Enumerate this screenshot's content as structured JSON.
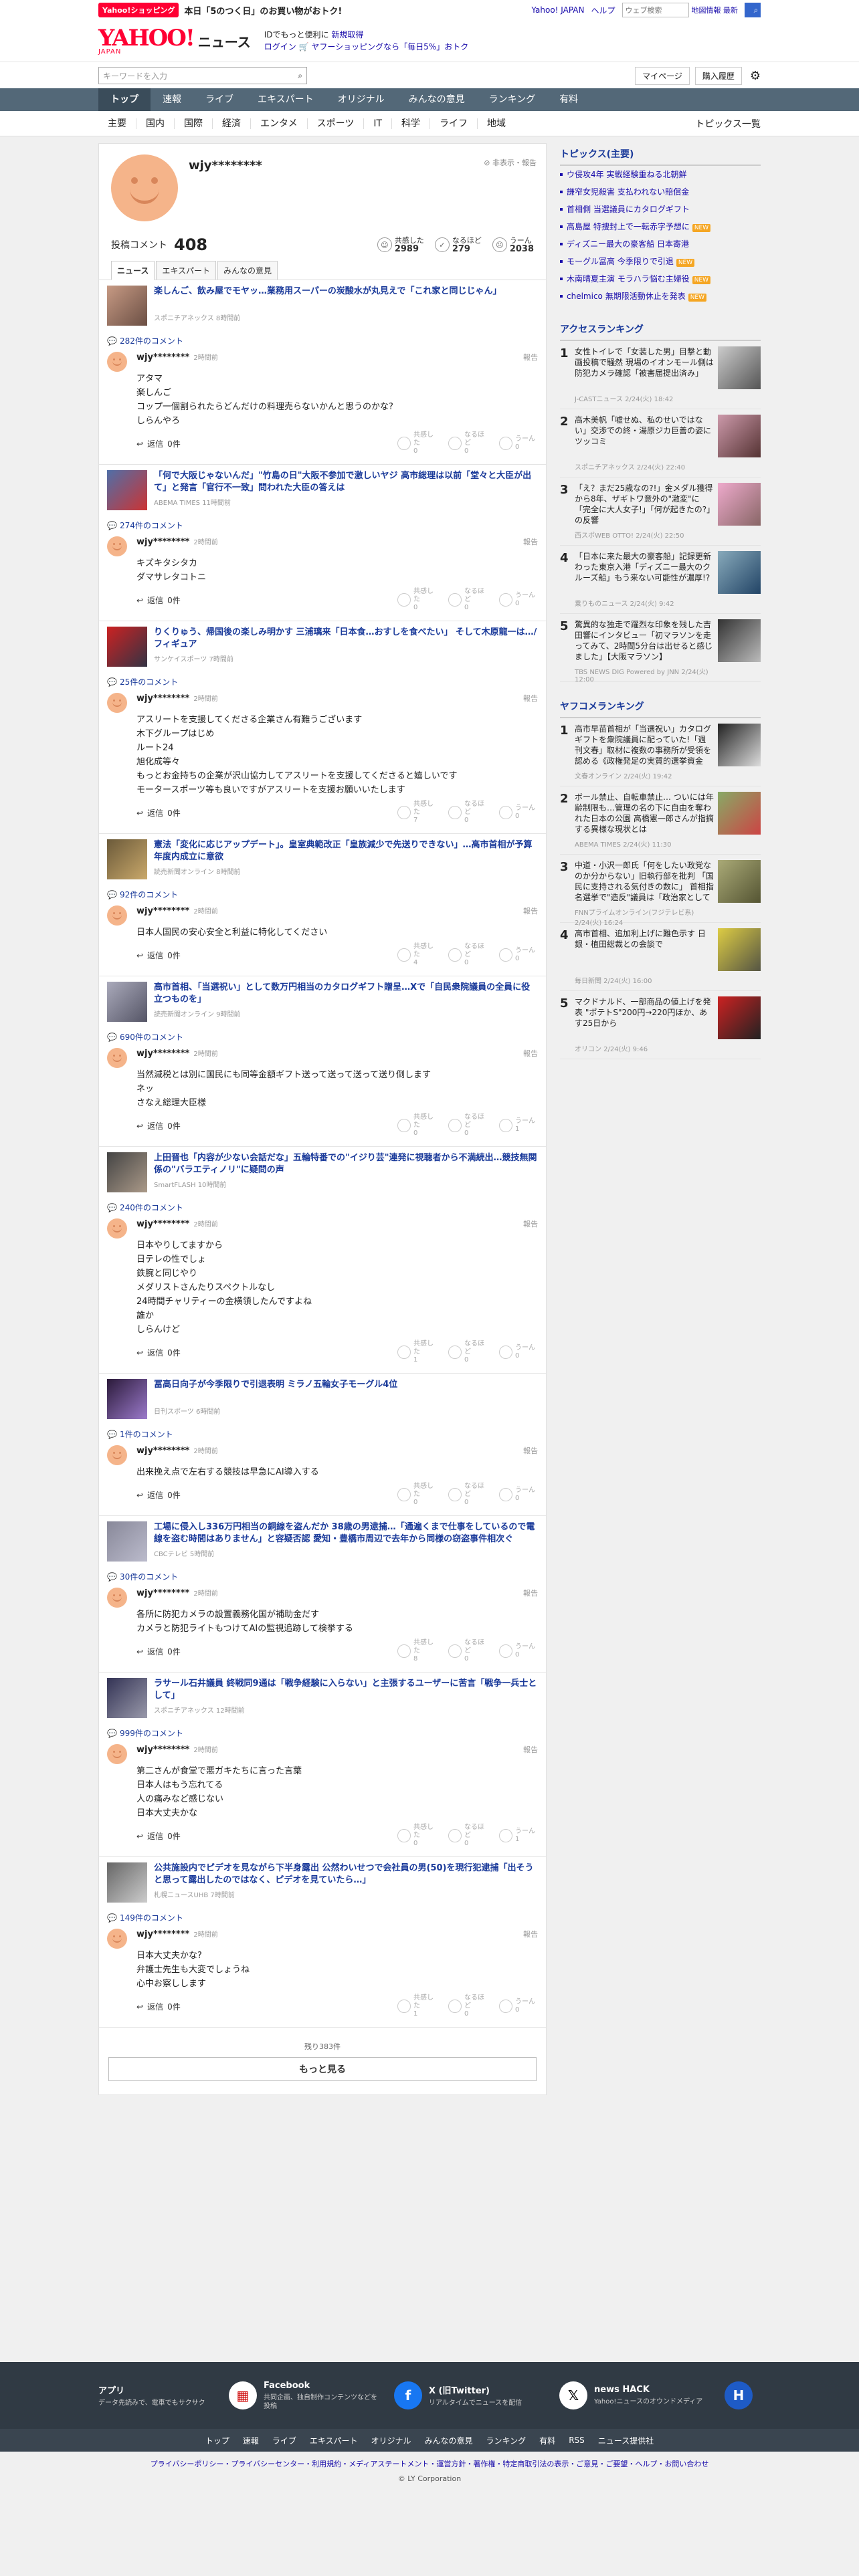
{
  "topbar": {
    "promo_badge": "Yahoo!ショッピング",
    "promo_text": "本日「5のつく日」のお買い物がおトク!",
    "yahoo_link": "Yahoo! JAPAN",
    "help_link": "ヘルプ",
    "search_placeholder": "ウェブ検索",
    "map_label": "地図情報 最新"
  },
  "header": {
    "logo": "YAHOO!",
    "logo_sub": "JAPAN",
    "news": "ニュース",
    "msg_line1_a": "IDでもっと便利に",
    "msg_line1_b": "新規取得",
    "msg_line2_a": "ログイン",
    "msg_line2_b": "ヤフーショッピングなら「毎日5%」おトク"
  },
  "toolbar": {
    "search_placeholder": "キーワードを入力",
    "mypage": "マイページ",
    "history": "購入履歴"
  },
  "global_nav": [
    "トップ",
    "速報",
    "ライブ",
    "エキスパート",
    "オリジナル",
    "みんなの意見",
    "ランキング",
    "有料"
  ],
  "category_nav": [
    "主要",
    "国内",
    "国際",
    "経済",
    "エンタメ",
    "スポーツ",
    "IT",
    "科学",
    "ライフ",
    "地域"
  ],
  "category_nav_end": "トピックス一覧",
  "profile": {
    "username": "wjy********",
    "report": "非表示・報告",
    "comments_label": "投稿コメント",
    "comments_count": "408",
    "reactions": [
      {
        "label": "共感した",
        "count": "2989"
      },
      {
        "label": "なるほど",
        "count": "279"
      },
      {
        "label": "うーん",
        "count": "2038"
      }
    ],
    "tabs": [
      "ニュース",
      "エキスパート",
      "みんなの意見"
    ]
  },
  "comment_ui": {
    "report": "報告",
    "reply": "返信",
    "reply_count": "0件",
    "vote_labels": [
      "共感した",
      "なるほど",
      "うーん"
    ],
    "load_remaining": "残り383件",
    "load_more": "もっと見る"
  },
  "items": [
    {
      "title": "楽しんご、飲み屋でモヤッ…業務用スーパーの炭酸水が丸見えで「これ家と同じじゃん」",
      "source": "スポニチアネックス 8時間前",
      "comment_count": "282件のコメント",
      "user": "wjy********",
      "time": "2時間前",
      "body": [
        "アタマ",
        "楽しんご",
        "コップ一個割られたらどんだけの料理売らないかんと思うのかな?",
        "しらんやろ"
      ],
      "votes": [
        "0",
        "0",
        "0"
      ]
    },
    {
      "title": "「何で大阪じゃないんだ」\"竹島の日\"大阪不参加で激しいヤジ 高市総理は以前「堂々と大臣が出て」と発言「官行不一致」問われた大臣の答えは",
      "source": "ABEMA TIMES 11時間前",
      "comment_count": "274件のコメント",
      "user": "wjy********",
      "time": "2時間前",
      "body": [
        "キズキタシタカ",
        "ダマサレタコトニ"
      ],
      "votes": [
        "0",
        "0",
        "0"
      ]
    },
    {
      "title": "りくりゅう、帰国後の楽しみ明かす 三浦璃来「日本食…おすしを食べたい」 そして木原龍一は…/フィギュア",
      "source": "サンケイスポーツ 7時間前",
      "comment_count": "25件のコメント",
      "user": "wjy********",
      "time": "2時間前",
      "body": [
        "アスリートを支援してくださる企業さん有難うございます",
        "木下グループはじめ",
        "ルート24",
        "旭化成等々",
        "もっとお金持ちの企業が沢山協力してアスリートを支援してくださると嬉しいです",
        "モータースポーツ等も良いですがアスリートを支援お願いいたします"
      ],
      "votes": [
        "7",
        "0",
        "0"
      ]
    },
    {
      "title": "憲法「変化に応じアップデート」。皇室典範改正「皇族減少で先送りできない」…高市首相が予算年度内成立に意欲",
      "source": "読売新聞オンライン 8時間前",
      "comment_count": "92件のコメント",
      "user": "wjy********",
      "time": "2時間前",
      "body": [
        "日本人国民の安心安全と利益に特化してください"
      ],
      "votes": [
        "4",
        "0",
        "0"
      ]
    },
    {
      "title": "高市首相、「当選祝い」として数万円相当のカタログギフト贈呈…Xで「自民衆院議員の全員に役立つものを」",
      "source": "読売新聞オンライン 9時間前",
      "comment_count": "690件のコメント",
      "user": "wjy********",
      "time": "2時間前",
      "body": [
        "当然減税とは別に国民にも同等金額ギフト送って送って送って送り倒します",
        "ネッ",
        "さなえ総理大臣様"
      ],
      "votes": [
        "0",
        "0",
        "1"
      ]
    },
    {
      "title": "上田晋也「内容が少ない会話だな」五輪特番での\"イジり芸\"連発に視聴者から不満続出…競技無関係の\"バラエティノリ\"に疑問の声",
      "source": "SmartFLASH 10時間前",
      "comment_count": "240件のコメント",
      "user": "wjy********",
      "time": "2時間前",
      "body": [
        "日本やりしてますから",
        "日テレの性でしょ",
        "鉄腕と同じやり",
        "メダリストさんたりスペクトルなし",
        "24時間チャリティーの金横領したんですよね",
        "誰か",
        "しらんけど"
      ],
      "votes": [
        "1",
        "0",
        "0"
      ]
    },
    {
      "title": "冨高日向子が今季限りで引退表明 ミラノ五輪女子モーグル4位",
      "source": "日刊スポーツ 6時間前",
      "comment_count": "1件のコメント",
      "user": "wjy********",
      "time": "2時間前",
      "body": [
        "出来挽え点で左右する競技は早急にAI導入する"
      ],
      "votes": [
        "0",
        "0",
        "0"
      ]
    },
    {
      "title": "工場に侵入し336万円相当の銅線を盗んだか 38歳の男逮捕…「通遍くまで仕事をしているので電線を盗む時間はありません」と容疑否認 愛知・豊橋市周辺で去年から同様の窃盗事件相次ぐ",
      "source": "CBCテレビ 5時間前",
      "comment_count": "30件のコメント",
      "user": "wjy********",
      "time": "2時間前",
      "body": [
        "各所に防犯カメラの設置義務化国が補助金だす",
        "カメラと防犯ライトもつけてAIの監視追跡して検挙する"
      ],
      "votes": [
        "8",
        "0",
        "0"
      ]
    },
    {
      "title": "ラサール石井議員 終戦同9通は「戦争経験に入らない」と主張するユーザーに苦言「戦争一兵士として」",
      "source": "スポニチアネックス 12時間前",
      "comment_count": "999件のコメント",
      "user": "wjy********",
      "time": "2時間前",
      "body": [
        "第二さんが食堂で悪ガキたちに言った言葉",
        "日本人はもう忘れてる",
        "人の痛みなど感じない",
        "日本大丈夫かな"
      ],
      "votes": [
        "0",
        "0",
        "1"
      ]
    },
    {
      "title": "公共施設内でピデオを見ながら下半身露出 公然わいせつで会社員の男(50)を現行犯逮捕「出そうと思って露出したのではなく、ピデオを見ていたら…」",
      "source": "札幌ニュースUHB 7時間前",
      "comment_count": "149件のコメント",
      "user": "wjy********",
      "time": "2時間前",
      "body": [
        "日本大丈夫かな?",
        "弁護士先生も大変でしょうね",
        "心中お察しします"
      ],
      "votes": [
        "1",
        "0",
        "0"
      ]
    }
  ],
  "sidebar": {
    "topics_title": "トピックス(主要)",
    "topics": [
      {
        "text": "ウ侵攻4年 実戦経験重ねる北朝鮮",
        "new": false
      },
      {
        "text": "謙窄女児殺害 支払われない賠償金",
        "new": false
      },
      {
        "text": "首相側 当選議員にカタログギフト",
        "new": false
      },
      {
        "text": "高島屋 特捜封上で一転赤字予想に",
        "new": true
      },
      {
        "text": "ディズニー最大の豪客船 日本寄港",
        "new": false
      },
      {
        "text": "モーグル冨高 今季限りで引退",
        "new": true
      },
      {
        "text": "木南晴夏主演 モラハラ悩む主婦役",
        "new": true
      },
      {
        "text": "chelmico 無期限活動休止を発表",
        "new": true
      }
    ],
    "new_tag": "NEW",
    "access_title": "アクセスランキング",
    "access": [
      {
        "rank": "1",
        "title": "女性トイレで「女装した男」目撃と動画投稿で騒然 現場のイオンモール側は防犯カメラ確認「被害届提出済み」",
        "src": "J-CASTニュース 2/24(火) 18:42"
      },
      {
        "rank": "2",
        "title": "高木美帆「嘘せぬ、私のせいではない」交渉での終・湯原ジカ巨善の姿にツッコミ",
        "src": "スポニチアネックス 2/24(火) 22:40"
      },
      {
        "rank": "3",
        "title": "「え？まだ25歳なの?!」金メダル獲得から8年、ザギトワ意外の\"激変\"に「完全に大人女子!」「何が起きたの?」の反響",
        "src": "西スポWEB OTTO! 2/24(火) 22:50"
      },
      {
        "rank": "4",
        "title": "「日本に来た最大の豪客船」記録更新わった東京入港「ディズニー最大のクルーズ船」もう来ない可能性が濃厚!?",
        "src": "乗りものニュース 2/24(火) 9:42"
      },
      {
        "rank": "5",
        "title": "驚異的な独走で躍烈な印象を残した吉田響にインタビュー「初マラソンを走ってみて、2時間5分台は出せると感じました」【大阪マラソン】",
        "src": "TBS NEWS DIG Powered by JNN 2/24(火) 12:00"
      }
    ],
    "yafoco_title": "ヤフコメランキング",
    "yafoco": [
      {
        "rank": "1",
        "title": "高市早苗首相が「当選祝い」カタログギフトを衆院議員に配っていた!「週刊文春」取材に複数の事務所が受領を認める《政権発足の実質的選挙資金で…》",
        "src": "文春オンライン 2/24(火) 19:42"
      },
      {
        "rank": "2",
        "title": "ボール禁止、自転車禁止… ついには年齢制限も…管理の名の下に自由を奪われた日本の公園 高橋憲一郎さんが指摘する異様な現状とは",
        "src": "ABEMA TIMES 2/24(火) 11:30"
      },
      {
        "rank": "3",
        "title": "中道・小沢一郎氏「何をしたい政党なのか分からない」旧執行部を批判 「国民に支持される気付きの数に」 首相指名選挙で\"造反\"議員は「政治家としてはいい生き方」",
        "src": "FNNプライムオンライン(フジテレビ系) 2/24(火) 16:24"
      },
      {
        "rank": "4",
        "title": "高市首相、追加利上げに難色示す 日銀・植田総裁との会談で",
        "src": "毎日新聞 2/24(火) 16:00"
      },
      {
        "rank": "5",
        "title": "マクドナルド、一部商品の値上げを発表 \"ポテトS\"200円→220円ほか、あす25日から",
        "src": "オリコン 2/24(火) 9:46"
      }
    ]
  },
  "footer": {
    "apps": [
      {
        "title": "アプリ",
        "desc": "データ先読みで、電車でもサクサク",
        "icon": "app-icon"
      },
      {
        "title": "Facebook",
        "desc": "共同企画、独自制作コンテンツなどを投稿",
        "icon": "facebook-icon"
      },
      {
        "title": "X (旧Twitter)",
        "desc": "リアルタイムでニュースを配信",
        "icon": "x-icon"
      },
      {
        "title": "news HACK",
        "desc": "Yahoo!ニュースのオウンドメディア",
        "icon": "newshack-icon"
      }
    ],
    "nav": [
      "トップ",
      "速報",
      "ライブ",
      "エキスパート",
      "オリジナル",
      "みんなの意見",
      "ランキング",
      "有料",
      "RSS",
      "ニュース提供社"
    ],
    "legal": "プライバシーポリシー・プライバシーセンター・利用規約・メディアステートメント・運営方針・著作権・特定商取引法の表示・ご意見・ご要望・ヘルプ・お問い合わせ",
    "copyright": "© LY Corporation"
  },
  "colors": {
    "nav_bg": "#536878",
    "link": "#1a3a9a",
    "brand": "#ff0033",
    "footer_bg": "#303a44"
  }
}
